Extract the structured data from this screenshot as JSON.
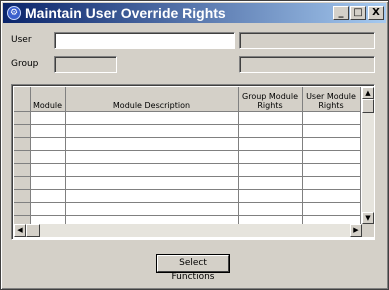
{
  "window": {
    "title": "Maintain User Override Rights",
    "controls": {
      "minimize": "_",
      "maximize": "□",
      "close": "X"
    }
  },
  "form": {
    "user_label": "User",
    "user_value": "",
    "group_label": "Group"
  },
  "grid": {
    "columns": [
      "",
      "Module",
      "Module Description",
      "Group Module Rights",
      "User Module Rights"
    ],
    "row_count": 9
  },
  "actions": {
    "select_functions_label": "Select Functions"
  }
}
